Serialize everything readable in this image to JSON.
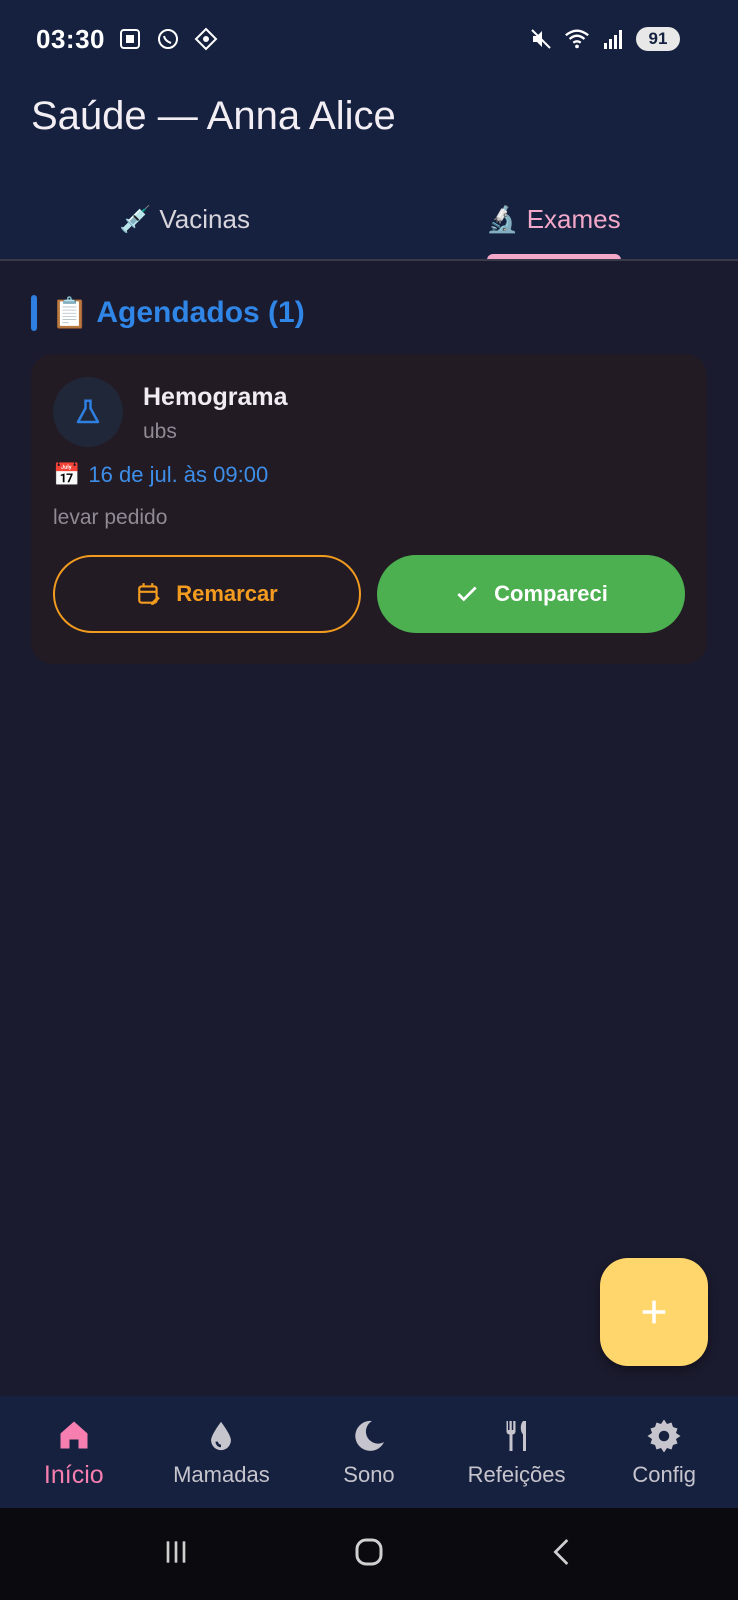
{
  "status": {
    "time": "03:30",
    "battery": "91",
    "left_icons": [
      "screenshot-icon",
      "whatsapp-icon",
      "app-icon"
    ],
    "right_icons": [
      "mute-icon",
      "wifi-icon",
      "signal-icon"
    ]
  },
  "header": {
    "title": "Saúde — Anna Alice"
  },
  "tabs": [
    {
      "emoji": "💉",
      "label": "Vacinas",
      "active": false
    },
    {
      "emoji": "🔬",
      "label": "Exames",
      "active": true
    }
  ],
  "section": {
    "emoji": "📋",
    "title": "Agendados (1)"
  },
  "card": {
    "title": "Hemograma",
    "subtitle": "ubs",
    "date_emoji": "📅",
    "date": "16 de jul. às 09:00",
    "note": "levar pedido",
    "reschedule_label": "Remarcar",
    "attended_label": "Compareci"
  },
  "fab": {
    "icon": "plus-icon"
  },
  "bottom_nav": [
    {
      "label": "Início",
      "icon": "home-icon",
      "active": true
    },
    {
      "label": "Mamadas",
      "icon": "drop-icon",
      "active": false
    },
    {
      "label": "Sono",
      "icon": "moon-icon",
      "active": false
    },
    {
      "label": "Refeições",
      "icon": "fork-knife-icon",
      "active": false
    },
    {
      "label": "Config",
      "icon": "gear-icon",
      "active": false
    }
  ],
  "colors": {
    "accent_pink": "#f4a8c9",
    "section_blue": "#2f86e6",
    "reschedule_orange": "#f39c1f",
    "attended_green": "#4caf50",
    "fab_yellow": "#ffd66b"
  }
}
